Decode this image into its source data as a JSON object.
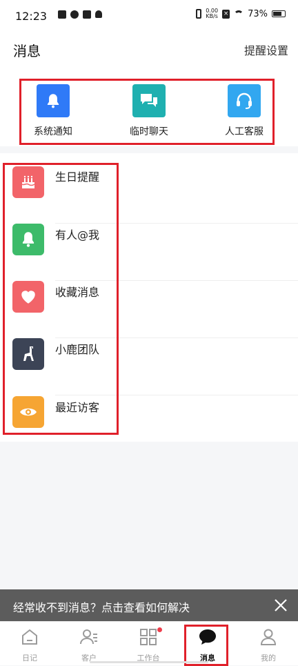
{
  "status_bar": {
    "time": "12:23",
    "net_speed_top": "0.00",
    "net_speed_bottom": "KB/s",
    "battery": "73%"
  },
  "header": {
    "title": "消息",
    "settings_label": "提醒设置"
  },
  "quick_actions": [
    {
      "label": "系统通知",
      "icon": "bell-icon",
      "color": "#2f7af7"
    },
    {
      "label": "临时聊天",
      "icon": "chat-icon",
      "color": "#1fb0b0"
    },
    {
      "label": "人工客服",
      "icon": "headset-icon",
      "color": "#32a7f0"
    }
  ],
  "message_list": [
    {
      "label": "生日提醒",
      "icon": "cake-icon",
      "color": "#f26469"
    },
    {
      "label": "有人@我",
      "icon": "bell-icon",
      "color": "#3dbb6a"
    },
    {
      "label": "收藏消息",
      "icon": "heart-icon",
      "color": "#f26469"
    },
    {
      "label": "小鹿团队",
      "icon": "deer-icon",
      "color": "#3c4456"
    },
    {
      "label": "最近访客",
      "icon": "eye-icon",
      "color": "#f6a533"
    }
  ],
  "banner": {
    "text": "经常收不到消息？点击查看如何解决"
  },
  "tabs": [
    {
      "label": "日记",
      "icon": "diary-icon"
    },
    {
      "label": "客户",
      "icon": "customers-icon"
    },
    {
      "label": "工作台",
      "icon": "workbench-icon"
    },
    {
      "label": "消息",
      "icon": "message-icon",
      "active": true
    },
    {
      "label": "我的",
      "icon": "profile-icon"
    }
  ],
  "colors": {
    "highlight": "#e0202a",
    "badge": "#ee3d4b"
  }
}
